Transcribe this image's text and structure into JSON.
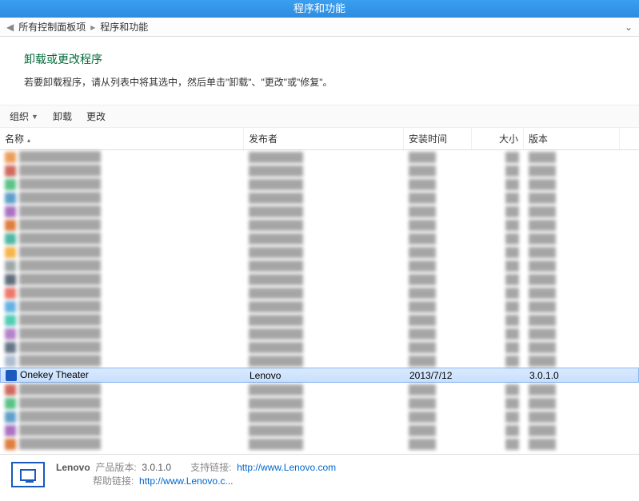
{
  "title": "程序和功能",
  "breadcrumb": {
    "item1": "所有控制面板项",
    "item2": "程序和功能"
  },
  "page": {
    "heading": "卸载或更改程序",
    "subheading": "若要卸载程序，请从列表中将其选中，然后单击\"卸载\"、\"更改\"或\"修复\"。"
  },
  "toolbar": {
    "org": "组织",
    "uninstall": "卸载",
    "change": "更改"
  },
  "columns": {
    "name": "名称",
    "publisher": "发布者",
    "date": "安装时间",
    "size": "大小",
    "version": "版本"
  },
  "selected": {
    "name": "Onekey Theater",
    "publisher": "Lenovo",
    "date": "2013/7/12",
    "size": "",
    "version": "3.0.1.0"
  },
  "details": {
    "vendor": "Lenovo",
    "ver_label": "产品版本:",
    "ver": "3.0.1.0",
    "support_label": "支持链接:",
    "support": "http://www.Lenovo.com",
    "help_label": "帮助链接:",
    "help": "http://www.Lenovo.c..."
  }
}
